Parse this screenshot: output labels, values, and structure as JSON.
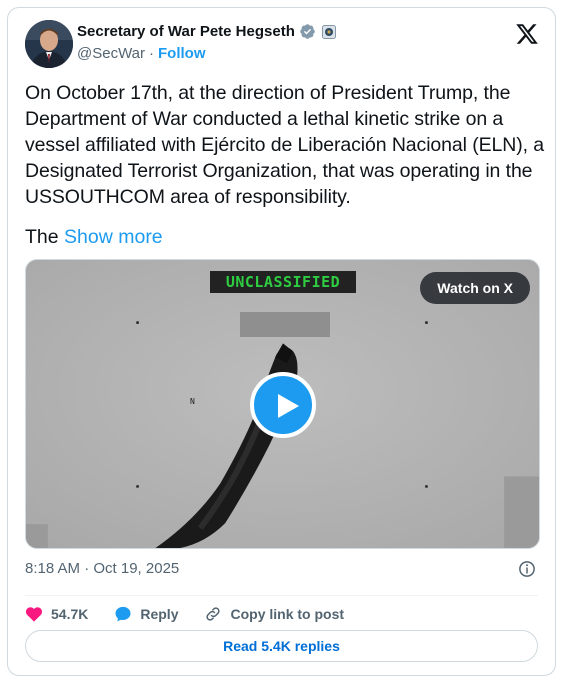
{
  "author": {
    "name": "Secretary of War Pete Hegseth",
    "handle": "@SecWar",
    "separator": "·",
    "follow_label": "Follow",
    "verified_badge": "verified-check-icon",
    "affiliation_badge": "government-seal-icon"
  },
  "platform_logo": "x-logo-icon",
  "tweet": {
    "text": "On October 17th, at the direction of President Trump, the Department of War conducted a lethal kinetic strike on a vessel affiliated with Ejército de Liberación Nacional (ELN), a Designated Terrorist Organization, that was operating in the USSOUTHCOM area of responsibility.",
    "truncated_start": "The",
    "show_more_label": "Show more"
  },
  "media": {
    "overlay_label": "UNCLASSIFIED",
    "watch_label": "Watch on X",
    "compass_label": "N",
    "play_icon": "play-icon"
  },
  "timestamp": "8:18 AM · Oct 19, 2025",
  "actions": {
    "like_count": "54.7K",
    "reply_label": "Reply",
    "copy_link_label": "Copy link to post"
  },
  "read_replies_label": "Read 5.4K replies",
  "colors": {
    "accent": "#1d9bf0",
    "like": "#f91880",
    "text": "#0f1419",
    "muted": "#536471",
    "overlay_green": "#2ecc40"
  }
}
